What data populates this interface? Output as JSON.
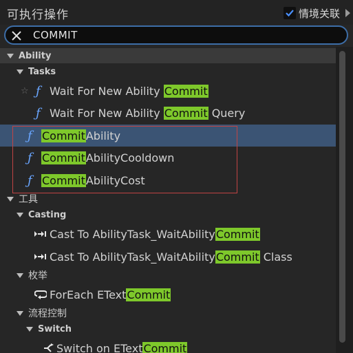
{
  "header": {
    "title": "可执行操作",
    "context_label": "情境关联",
    "context_checked": true
  },
  "search": {
    "value": "COMMIT"
  },
  "tree": {
    "ability": "Ability",
    "tasks": "Tasks",
    "wait1_prefix": "Wait For New Ability ",
    "wait2_prefix": "Wait For New Ability ",
    "wait2_suffix": " Query",
    "commit_ability_suffix": "Ability",
    "commit_cooldown_suffix": "AbilityCooldown",
    "commit_cost_suffix": "AbilityCost",
    "tools": "工具",
    "casting": "Casting",
    "cast1_prefix": "Cast To AbilityTask_WaitAbility",
    "cast2_prefix": "Cast To AbilityTask_WaitAbility",
    "cast2_suffix": " Class",
    "enum": "枚举",
    "foreach_prefix": "ForEach EText",
    "flow": "流程控制",
    "switch": "Switch",
    "switch_prefix": "Switch on EText",
    "match": "Commit"
  },
  "colors": {
    "highlight": "#7ec82b",
    "selection": "#3b5474",
    "annotation": "#c24444",
    "function_icon": "#6aa6ff"
  }
}
